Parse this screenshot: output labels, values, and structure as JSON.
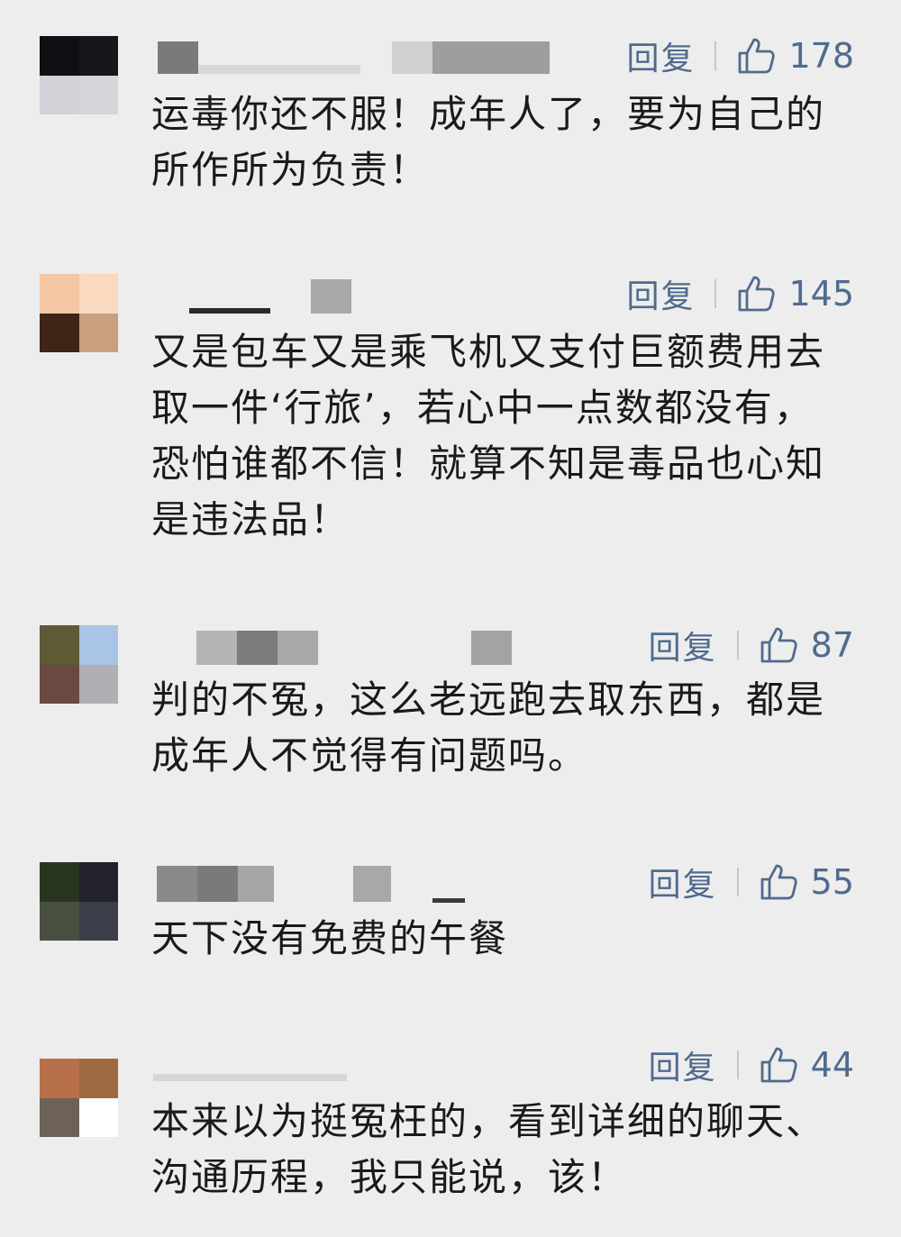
{
  "comments": [
    {
      "reply_label": "回复",
      "like_count": "178",
      "avatar_colors": [
        "#101014",
        "#17171b",
        "#d2d2d8",
        "#d6d6da"
      ],
      "lines": [
        "运毒你还不服！成年人了，要为自己的",
        "所作所为负责！"
      ]
    },
    {
      "reply_label": "回复",
      "like_count": "145",
      "avatar_colors": [
        "#f3c7a4",
        "#fad9c1",
        "#402417",
        "#c8a07f"
      ],
      "lines": [
        "又是包车又是乘飞机又支付巨额费用去",
        "取一件‘行旅’，若心中一点数都没有，",
        "恐怕谁都不信！就算不知是毒品也心知",
        "是违法品！"
      ]
    },
    {
      "reply_label": "回复",
      "like_count": "87",
      "avatar_colors": [
        "#5e5a36",
        "#a8c4e6",
        "#6a4a40",
        "#b1aeb4"
      ],
      "lines": [
        "判的不冤，这么老远跑去取东西，都是",
        "成年人不觉得有问题吗。"
      ]
    },
    {
      "reply_label": "回复",
      "like_count": "55",
      "avatar_colors": [
        "#2a3520",
        "#22222a",
        "#4a5040",
        "#3c3e4a"
      ],
      "lines": [
        "天下没有免费的午餐"
      ]
    },
    {
      "reply_label": "回复",
      "like_count": "44",
      "avatar_colors": [
        "#b8704a",
        "#9e6a42",
        "#6e6258",
        "#ffffff"
      ],
      "lines": [
        "本来以为挺冤枉的，看到详细的聊天、",
        "沟通历程，我只能说，该！"
      ]
    }
  ],
  "icons": {
    "like": "thumbs-up-icon"
  },
  "colors": {
    "background": "#ededed",
    "action_blue": "#4f6b8d",
    "text": "#1a1a1a"
  }
}
